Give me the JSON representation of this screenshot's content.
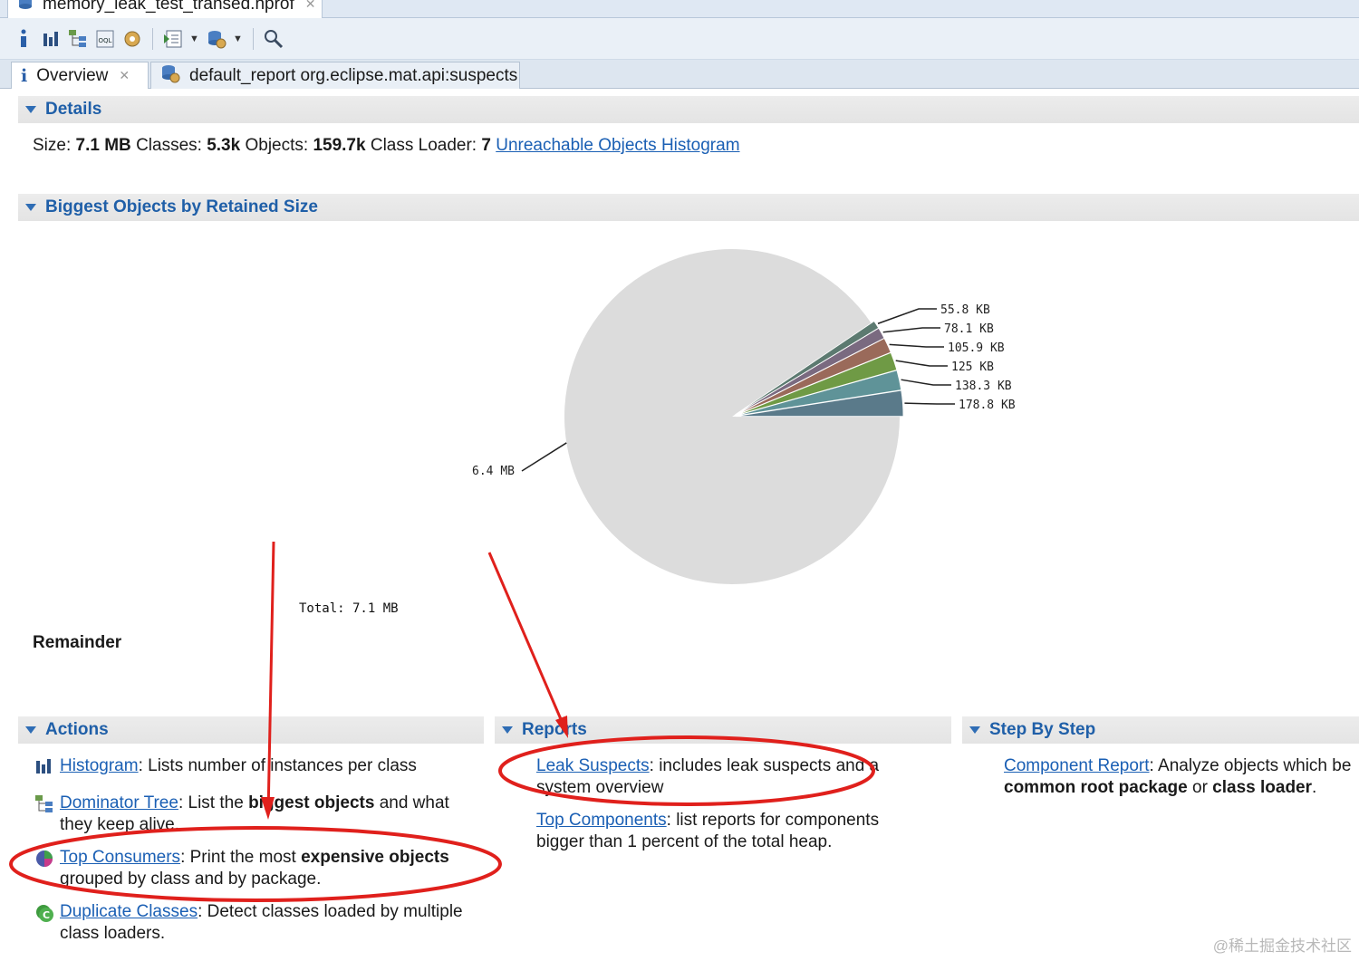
{
  "file_tab": {
    "label": "memory_leak_test_transed.hprof",
    "close": "✕"
  },
  "toolbar": {
    "icons": [
      "info-icon",
      "histogram-icon",
      "dominator-tree-icon",
      "oql-icon",
      "thread-overview-icon",
      "run-report-icon",
      "query-browser-icon",
      "search-icon"
    ]
  },
  "editor_tabs": [
    {
      "icon": "i",
      "label": "Overview",
      "close": "✕"
    },
    {
      "label": "default_report  org.eclipse.mat.api:suspects"
    }
  ],
  "details": {
    "title": "Details",
    "size_label": "Size:",
    "size_value": "7.1 MB",
    "classes_label": "Classes:",
    "classes_value": "5.3k",
    "objects_label": "Objects:",
    "objects_value": "159.7k",
    "loader_label": "Class Loader:",
    "loader_value": "7",
    "unreachable_link": "Unreachable Objects Histogram"
  },
  "biggest": {
    "title": "Biggest Objects by Retained Size",
    "remainder": "Remainder"
  },
  "chart_data": {
    "type": "pie",
    "unit": "KB",
    "slices": [
      {
        "label": "6.4 MB",
        "value": 6553.6,
        "color": "#dcdcdc"
      },
      {
        "label": "178.8 KB",
        "value": 178.8,
        "color": "#5a7a8a"
      },
      {
        "label": "138.3 KB",
        "value": 138.3,
        "color": "#5f9398"
      },
      {
        "label": "125 KB",
        "value": 125,
        "color": "#6f9a45"
      },
      {
        "label": "105.9 KB",
        "value": 105.9,
        "color": "#9a6a5a"
      },
      {
        "label": "78.1 KB",
        "value": 78.1,
        "color": "#7a6a80"
      },
      {
        "label": "55.8 KB",
        "value": 55.8,
        "color": "#5c7a70"
      }
    ],
    "total_label": "Total: 7.1 MB"
  },
  "actions": {
    "title": "Actions",
    "items": [
      {
        "link": "Histogram",
        "text": ": Lists number of instances per class"
      },
      {
        "link": "Dominator Tree",
        "text_pre": ": List the ",
        "bold": "biggest objects",
        "text_post": " and what they keep alive."
      },
      {
        "link": "Top Consumers",
        "text_pre": ": Print the most ",
        "bold": "expensive objects",
        "text_post": " grouped by class and by package."
      },
      {
        "link": "Duplicate Classes",
        "text": ": Detect classes loaded by multiple class loaders."
      }
    ]
  },
  "reports": {
    "title": "Reports",
    "items": [
      {
        "link": "Leak Suspects",
        "text": ": includes leak suspects and a system overview"
      },
      {
        "link": "Top Components",
        "text": ": list reports for components bigger than 1 percent of the total heap."
      }
    ]
  },
  "stepbystep": {
    "title": "Step By Step",
    "item": {
      "link": "Component Report",
      "text_pre": ": Analyze objects which be",
      "bold1": "common root package",
      "mid": " or ",
      "bold2": "class loader",
      "end": "."
    }
  },
  "watermark": "@稀土掘金技术社区"
}
